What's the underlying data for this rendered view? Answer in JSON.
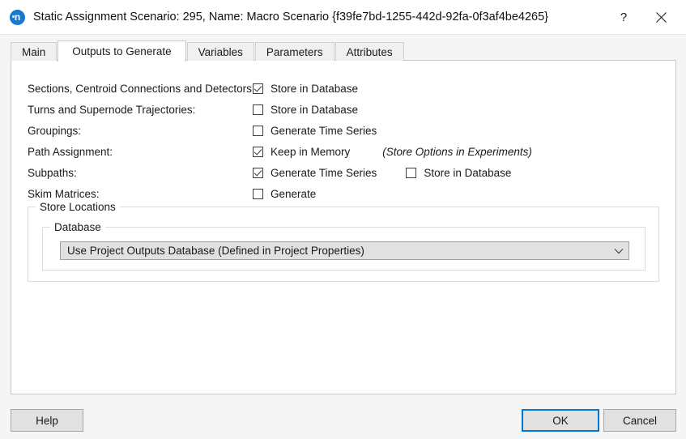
{
  "window": {
    "title": "Static Assignment Scenario: 295, Name: Macro Scenario",
    "guid": "{f39fe7bd-1255-442d-92fa-0f3af4be4265}",
    "app_icon_letter": "n",
    "help_button": "?",
    "close_button": "✕",
    "accent_color": "#0078d7",
    "icon_color": "#1878d0"
  },
  "tabs": [
    {
      "label": "Main",
      "active": false
    },
    {
      "label": "Outputs to Generate",
      "active": true
    },
    {
      "label": "Variables",
      "active": false
    },
    {
      "label": "Parameters",
      "active": false
    },
    {
      "label": "Attributes",
      "active": false
    }
  ],
  "outputs": {
    "rows": [
      {
        "label": "Sections, Centroid Connections and Detectors:",
        "checkbox_label": "Store in Database",
        "checked": true
      },
      {
        "label": "Turns and Supernode Trajectories:",
        "checkbox_label": "Store in Database",
        "checked": false
      },
      {
        "label": "Groupings:",
        "checkbox_label": "Generate Time Series",
        "checked": false
      },
      {
        "label": "Path Assignment:",
        "checkbox_label": "Keep in Memory",
        "checked": true,
        "note": "(Store Options in Experiments)"
      },
      {
        "label": "Subpaths:",
        "checkbox_label": "Generate Time Series",
        "checked": true,
        "checkbox2_label": "Store in Database",
        "checked2": false
      },
      {
        "label": "Skim Matrices:",
        "checkbox_label": "Generate",
        "checked": false
      }
    ]
  },
  "store_locations": {
    "group_title": "Store Locations",
    "database_group_title": "Database",
    "database_selected": "Use Project Outputs Database (Defined in Project Properties)"
  },
  "footer": {
    "help_label": "Help",
    "ok_label": "OK",
    "cancel_label": "Cancel"
  }
}
